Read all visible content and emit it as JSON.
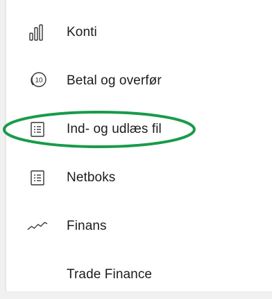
{
  "nav": {
    "items": [
      {
        "label": "Konti",
        "icon": "bar-chart-icon"
      },
      {
        "label": "Betal og overfør",
        "icon": "coin-10-icon"
      },
      {
        "label": "Ind- og udlæs fil",
        "icon": "file-list-icon"
      },
      {
        "label": "Netboks",
        "icon": "file-list-icon"
      },
      {
        "label": "Finans",
        "icon": "trend-line-icon"
      },
      {
        "label": "Trade Finance",
        "icon": ""
      }
    ]
  },
  "colors": {
    "text": "#1c1c1c",
    "icon": "#333333",
    "highlight_ring": "#1a9a4a",
    "panel_background": "#ffffff"
  },
  "coin_icon_text": "10"
}
